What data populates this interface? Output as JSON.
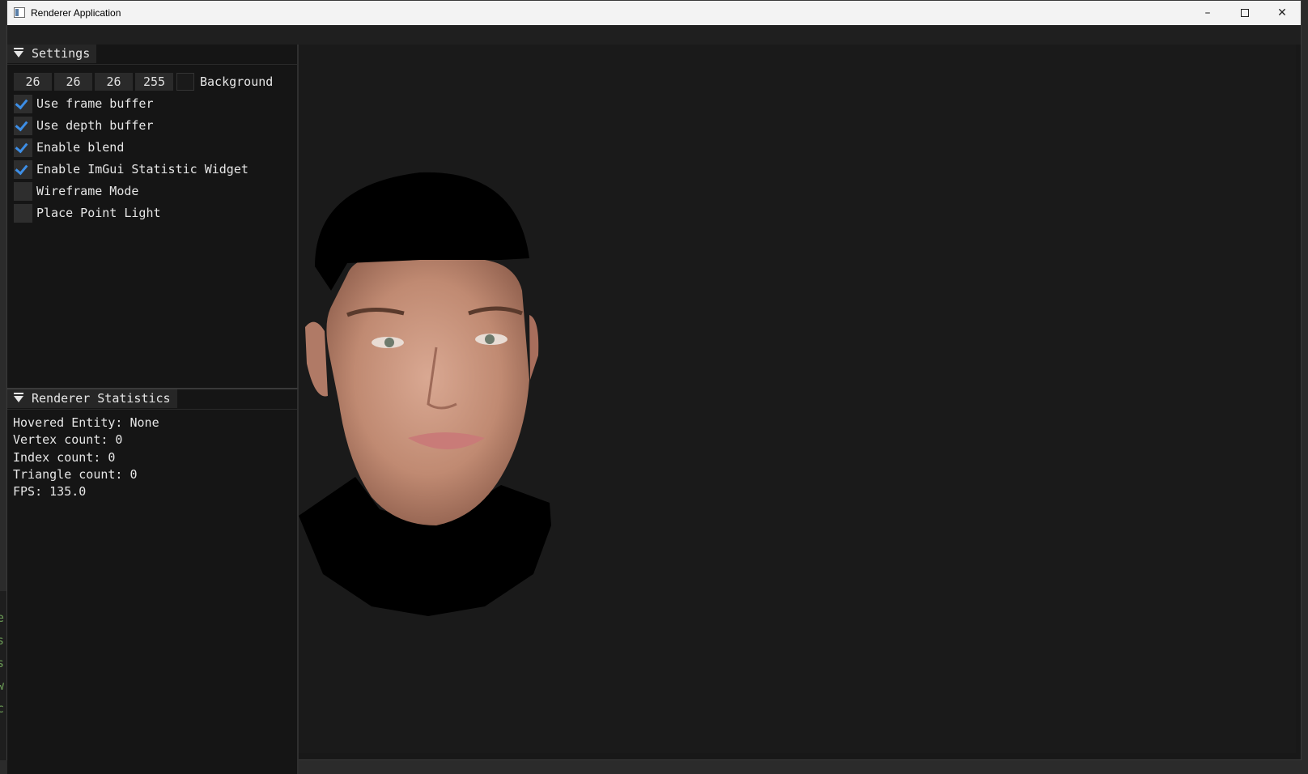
{
  "window": {
    "title": "Renderer Application"
  },
  "settings": {
    "header": "Settings",
    "background": {
      "r": "26",
      "g": "26",
      "b": "26",
      "a": "255",
      "label": "Background",
      "color": "#1a1a1a"
    },
    "checkboxes": [
      {
        "label": "Use frame buffer",
        "checked": true
      },
      {
        "label": "Use depth buffer",
        "checked": true
      },
      {
        "label": "Enable blend",
        "checked": true
      },
      {
        "label": "Enable ImGui Statistic Widget",
        "checked": true
      },
      {
        "label": "Wireframe Mode",
        "checked": false
      },
      {
        "label": "Place Point Light",
        "checked": false
      }
    ]
  },
  "stats": {
    "header": "Renderer Statistics",
    "hovered": "Hovered Entity: None",
    "vertex": "Vertex count: 0",
    "index": "Index count: 0",
    "triangle": "Triangle count: 0",
    "fps": "FPS: 135.0"
  },
  "colors": {
    "accent": "#3d8ee6",
    "panel_bg": "#151515",
    "viewport_bg": "#1a1a1a"
  }
}
